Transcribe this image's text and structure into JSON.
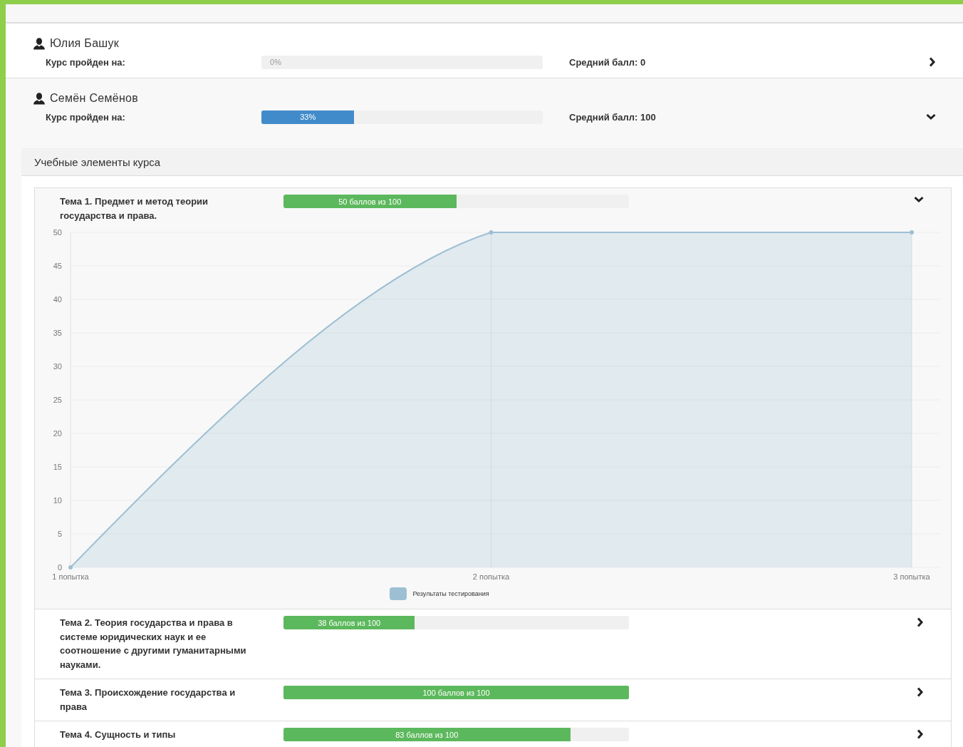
{
  "students": [
    {
      "name": "Юлия Башук",
      "progress_label": "Курс пройден на:",
      "progress_text": "0%",
      "level": 0,
      "average": "Средний балл: 0",
      "expanded": false
    },
    {
      "name": "Семён Семёнов",
      "progress_label": "Курс пройден на:",
      "progress_text": "33%",
      "level": 0.33,
      "average": "Средний балл: 100",
      "expanded": true,
      "course_elements": {
        "title": "Учебные элементы курса",
        "topics": [
          {
            "title": "Тема 1. Предмет и метод теории государства и права.",
            "score": "50 баллов из 100",
            "level": 0.5,
            "expanded": true,
            "chart_data": {
              "type": "area",
              "categories": [
                "1 попытка",
                "2 попытка",
                "3 попытка"
              ],
              "series": [
                {
                  "name": "Результаты тестирования",
                  "color": "#9dbfd3",
                  "values": [
                    0,
                    50,
                    50
                  ]
                }
              ],
              "ylim": [
                0,
                50
              ],
              "grid": true,
              "yticks": [
                0,
                5,
                10,
                15,
                20,
                25,
                30,
                35,
                40,
                45,
                50
              ]
            }
          },
          {
            "title": "Тема 2. Теория государства и права в системе юридических наук и ее соотношение с другими гуманитарными науками.",
            "score": "38 баллов из 100",
            "level": 0.38,
            "expanded": false
          },
          {
            "title": "Тема 3. Происхождение государства и права",
            "score": "100 баллов из 100",
            "level": 1,
            "expanded": false
          },
          {
            "title": "Тема 4. Сущность и типы",
            "score": "83 баллов из 100",
            "level": 0.83,
            "expanded": false
          }
        ]
      }
    }
  ]
}
